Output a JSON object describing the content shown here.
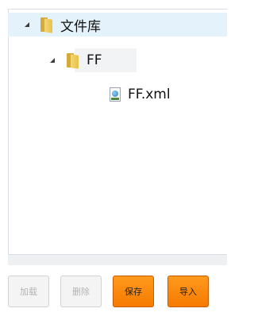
{
  "tree": {
    "root": {
      "label": "文件库",
      "icon": "folder-icon",
      "expanded": true
    },
    "child": {
      "label": "FF",
      "icon": "folder-icon",
      "expanded": true
    },
    "leaf": {
      "label": "FF.xml",
      "icon": "xml-file-icon"
    }
  },
  "buttons": {
    "load": "加载",
    "delete": "删除",
    "save": "保存",
    "import": "导入"
  },
  "colors": {
    "selection": "#e4f2fc",
    "primary_button": "#f57a00",
    "disabled_text": "#b4b4b4"
  }
}
